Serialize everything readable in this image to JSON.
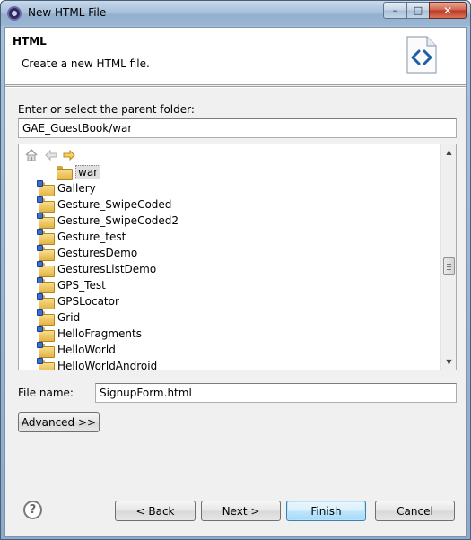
{
  "window": {
    "title": "New HTML File",
    "minimize_glyph": "–",
    "maximize_glyph": "□",
    "close_glyph": "✕"
  },
  "header": {
    "title": "HTML",
    "description": "Create a new HTML file."
  },
  "parent_folder": {
    "label": "Enter or select the parent folder:",
    "value": "GAE_GuestBook/war"
  },
  "tree": {
    "toolbar_icons": [
      "home-icon",
      "back-arrow-icon",
      "forward-arrow-icon"
    ],
    "items": [
      {
        "label": "war",
        "type": "folder",
        "selected": true
      },
      {
        "label": "Gallery",
        "type": "project"
      },
      {
        "label": "Gesture_SwipeCoded",
        "type": "project"
      },
      {
        "label": "Gesture_SwipeCoded2",
        "type": "project"
      },
      {
        "label": "Gesture_test",
        "type": "project"
      },
      {
        "label": "GesturesDemo",
        "type": "project"
      },
      {
        "label": "GesturesListDemo",
        "type": "project"
      },
      {
        "label": "GPS_Test",
        "type": "project"
      },
      {
        "label": "GPSLocator",
        "type": "project"
      },
      {
        "label": "Grid",
        "type": "project"
      },
      {
        "label": "HelloFragments",
        "type": "project"
      },
      {
        "label": "HelloWorld",
        "type": "project"
      },
      {
        "label": "HelloWorldAndroid",
        "type": "project"
      }
    ]
  },
  "file_name": {
    "label": "File name:",
    "value": "SignupForm.html"
  },
  "buttons": {
    "advanced": "Advanced >>",
    "back": "< Back",
    "next": "Next >",
    "finish": "Finish",
    "cancel": "Cancel",
    "help": "?"
  },
  "colors": {
    "selection": "#e0e0e0",
    "default_button_border": "#3c7fb1",
    "folder": "#e3b445"
  }
}
